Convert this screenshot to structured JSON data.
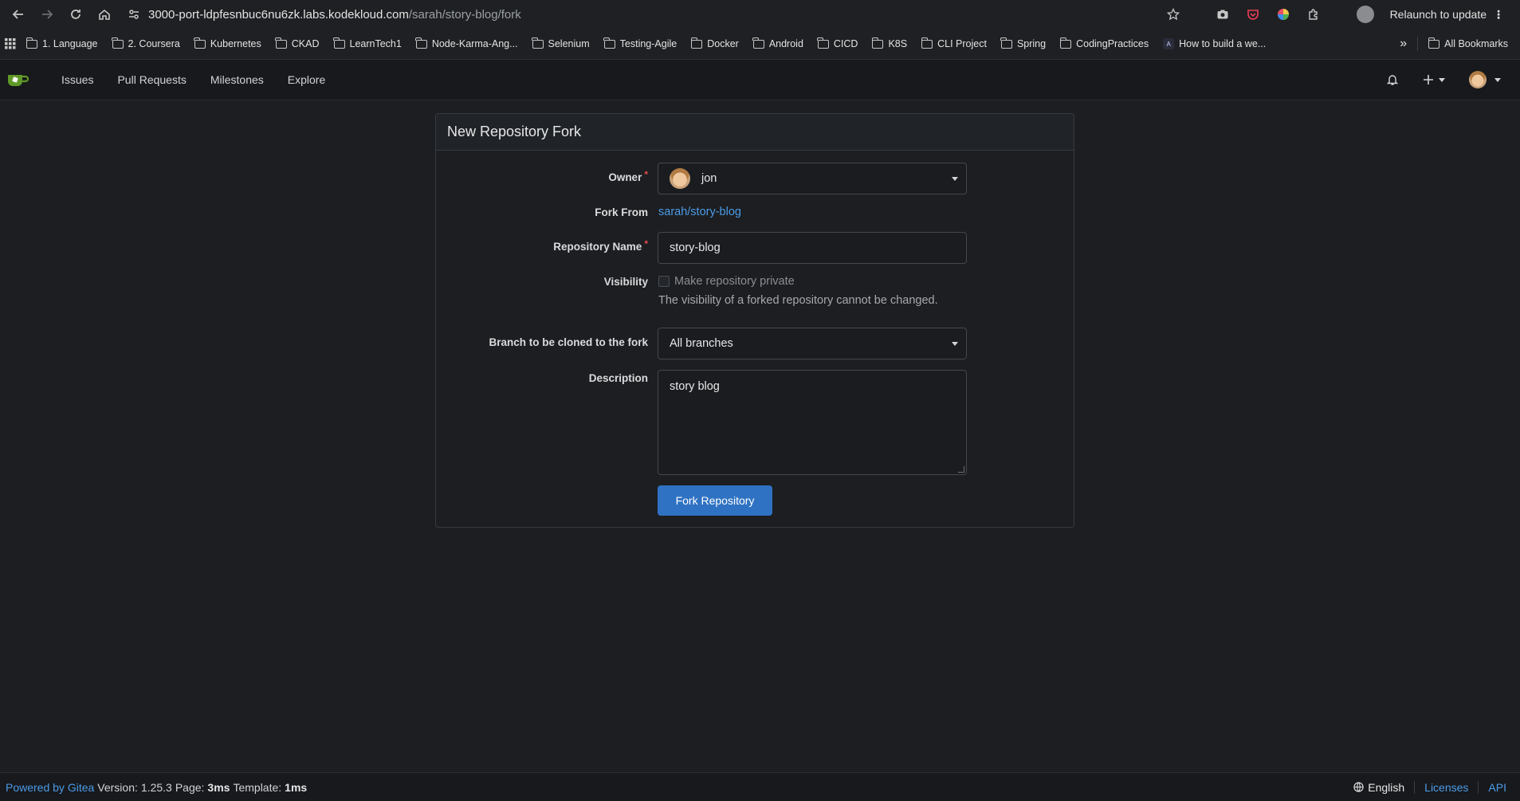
{
  "browser": {
    "url_host": "3000-port-ldpfesnbuc6nu6zk.labs.kodekloud.com",
    "url_path": "/sarah/story-blog/fork",
    "relaunch_label": "Relaunch to update"
  },
  "bookmarks": {
    "items": [
      "1. Language",
      "2. Coursera",
      "Kubernetes",
      "CKAD",
      "LearnTech1",
      "Node-Karma-Ang...",
      "Selenium",
      "Testing-Agile",
      "Docker",
      "Android",
      "CICD",
      "K8S",
      "CLI Project",
      "Spring",
      "CodingPractices",
      "How to build a we..."
    ],
    "more": "»",
    "all_bookmarks": "All Bookmarks"
  },
  "nav": {
    "issues": "Issues",
    "pull_requests": "Pull Requests",
    "milestones": "Milestones",
    "explore": "Explore"
  },
  "form": {
    "title": "New Repository Fork",
    "owner_label": "Owner",
    "owner_value": "jon",
    "fork_from_label": "Fork From",
    "fork_from_value": "sarah/story-blog",
    "repo_name_label": "Repository Name",
    "repo_name_value": "story-blog",
    "visibility_label": "Visibility",
    "visibility_checkbox": "Make repository private",
    "visibility_help": "The visibility of a forked repository cannot be changed.",
    "branch_label": "Branch to be cloned to the fork",
    "branch_value": "All branches",
    "description_label": "Description",
    "description_value": "story blog",
    "submit_label": "Fork Repository"
  },
  "footer": {
    "powered_by": "Powered by Gitea",
    "version_label": "Version:",
    "version_value": "1.25.3",
    "page_label": "Page:",
    "page_value": "3ms",
    "template_label": "Template:",
    "template_value": "1ms",
    "language": "English",
    "licenses": "Licenses",
    "api": "API"
  },
  "colors": {
    "accent": "#2f72c3",
    "link": "#4c9be8",
    "required": "#e5484d",
    "gitea_green": "#609926"
  }
}
